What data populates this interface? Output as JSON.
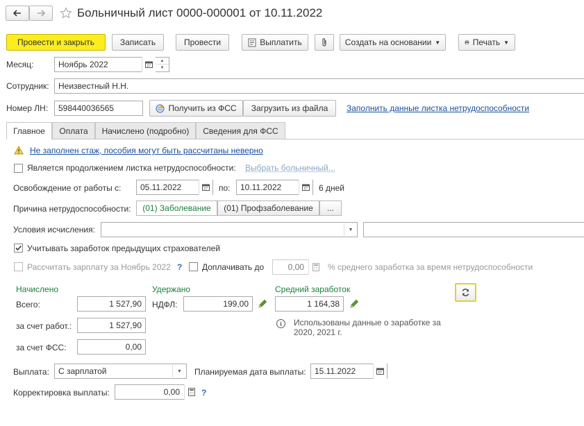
{
  "title": "Больничный лист 0000-000001 от 10.11.2022",
  "toolbar": {
    "post_close": "Провести и закрыть",
    "save": "Записать",
    "post": "Провести",
    "pay": "Выплатить",
    "create_based": "Создать на основании",
    "print": "Печать"
  },
  "month": {
    "label": "Месяц:",
    "value": "Ноябрь 2022"
  },
  "employee": {
    "label": "Сотрудник:",
    "value": "Неизвестный Н.Н."
  },
  "ln": {
    "label": "Номер ЛН:",
    "value": "598440036565",
    "get_fss": "Получить из ФСС",
    "load_file": "Загрузить из файла",
    "fill_link": "Заполнить данные листка нетрудоспособности"
  },
  "tabs": [
    "Главное",
    "Оплата",
    "Начислено (подробно)",
    "Сведения для ФСС"
  ],
  "warning": "Не заполнен стаж, пособия могут быть рассчитаны неверно",
  "continuation": {
    "label": "Является продолжением листка нетрудоспособности:",
    "link": "Выбрать больничный..."
  },
  "release": {
    "label": "Освобождение от работы с:",
    "from": "05.11.2022",
    "to_label": "по:",
    "to": "10.11.2022",
    "days": "6 дней"
  },
  "cause": {
    "label": "Причина нетрудоспособности:",
    "opt1": "(01) Заболевание",
    "opt2": "(01) Профзаболевание",
    "more": "..."
  },
  "conditions": {
    "label": "Условия исчисления:"
  },
  "prev_insurers": "Учитывать заработок предыдущих страхователей",
  "calc_salary": "Рассчитать зарплату за Ноябрь 2022",
  "question_mark": "?",
  "extra_pay": {
    "label": "Доплачивать до",
    "value": "0,00",
    "suffix": "% среднего заработка за время нетрудоспособности"
  },
  "accrued": {
    "header": "Начислено",
    "total_label": "Всего:",
    "total": "1 527,90",
    "employer_label": "за счет работ.:",
    "employer": "1 527,90",
    "fss_label": "за счет ФСС:",
    "fss": "0,00"
  },
  "withheld": {
    "header": "Удержано",
    "ndfl_label": "НДФЛ:",
    "ndfl": "199,00"
  },
  "average": {
    "header": "Средний заработок",
    "value": "1 164,38",
    "note": "Использованы данные о заработке за 2020,  2021 г."
  },
  "payment": {
    "label": "Выплата:",
    "value": "С зарплатой",
    "date_label": "Планируемая дата выплаты:",
    "date": "15.11.2022"
  },
  "correction": {
    "label": "Корректировка выплаты:",
    "value": "0,00"
  }
}
